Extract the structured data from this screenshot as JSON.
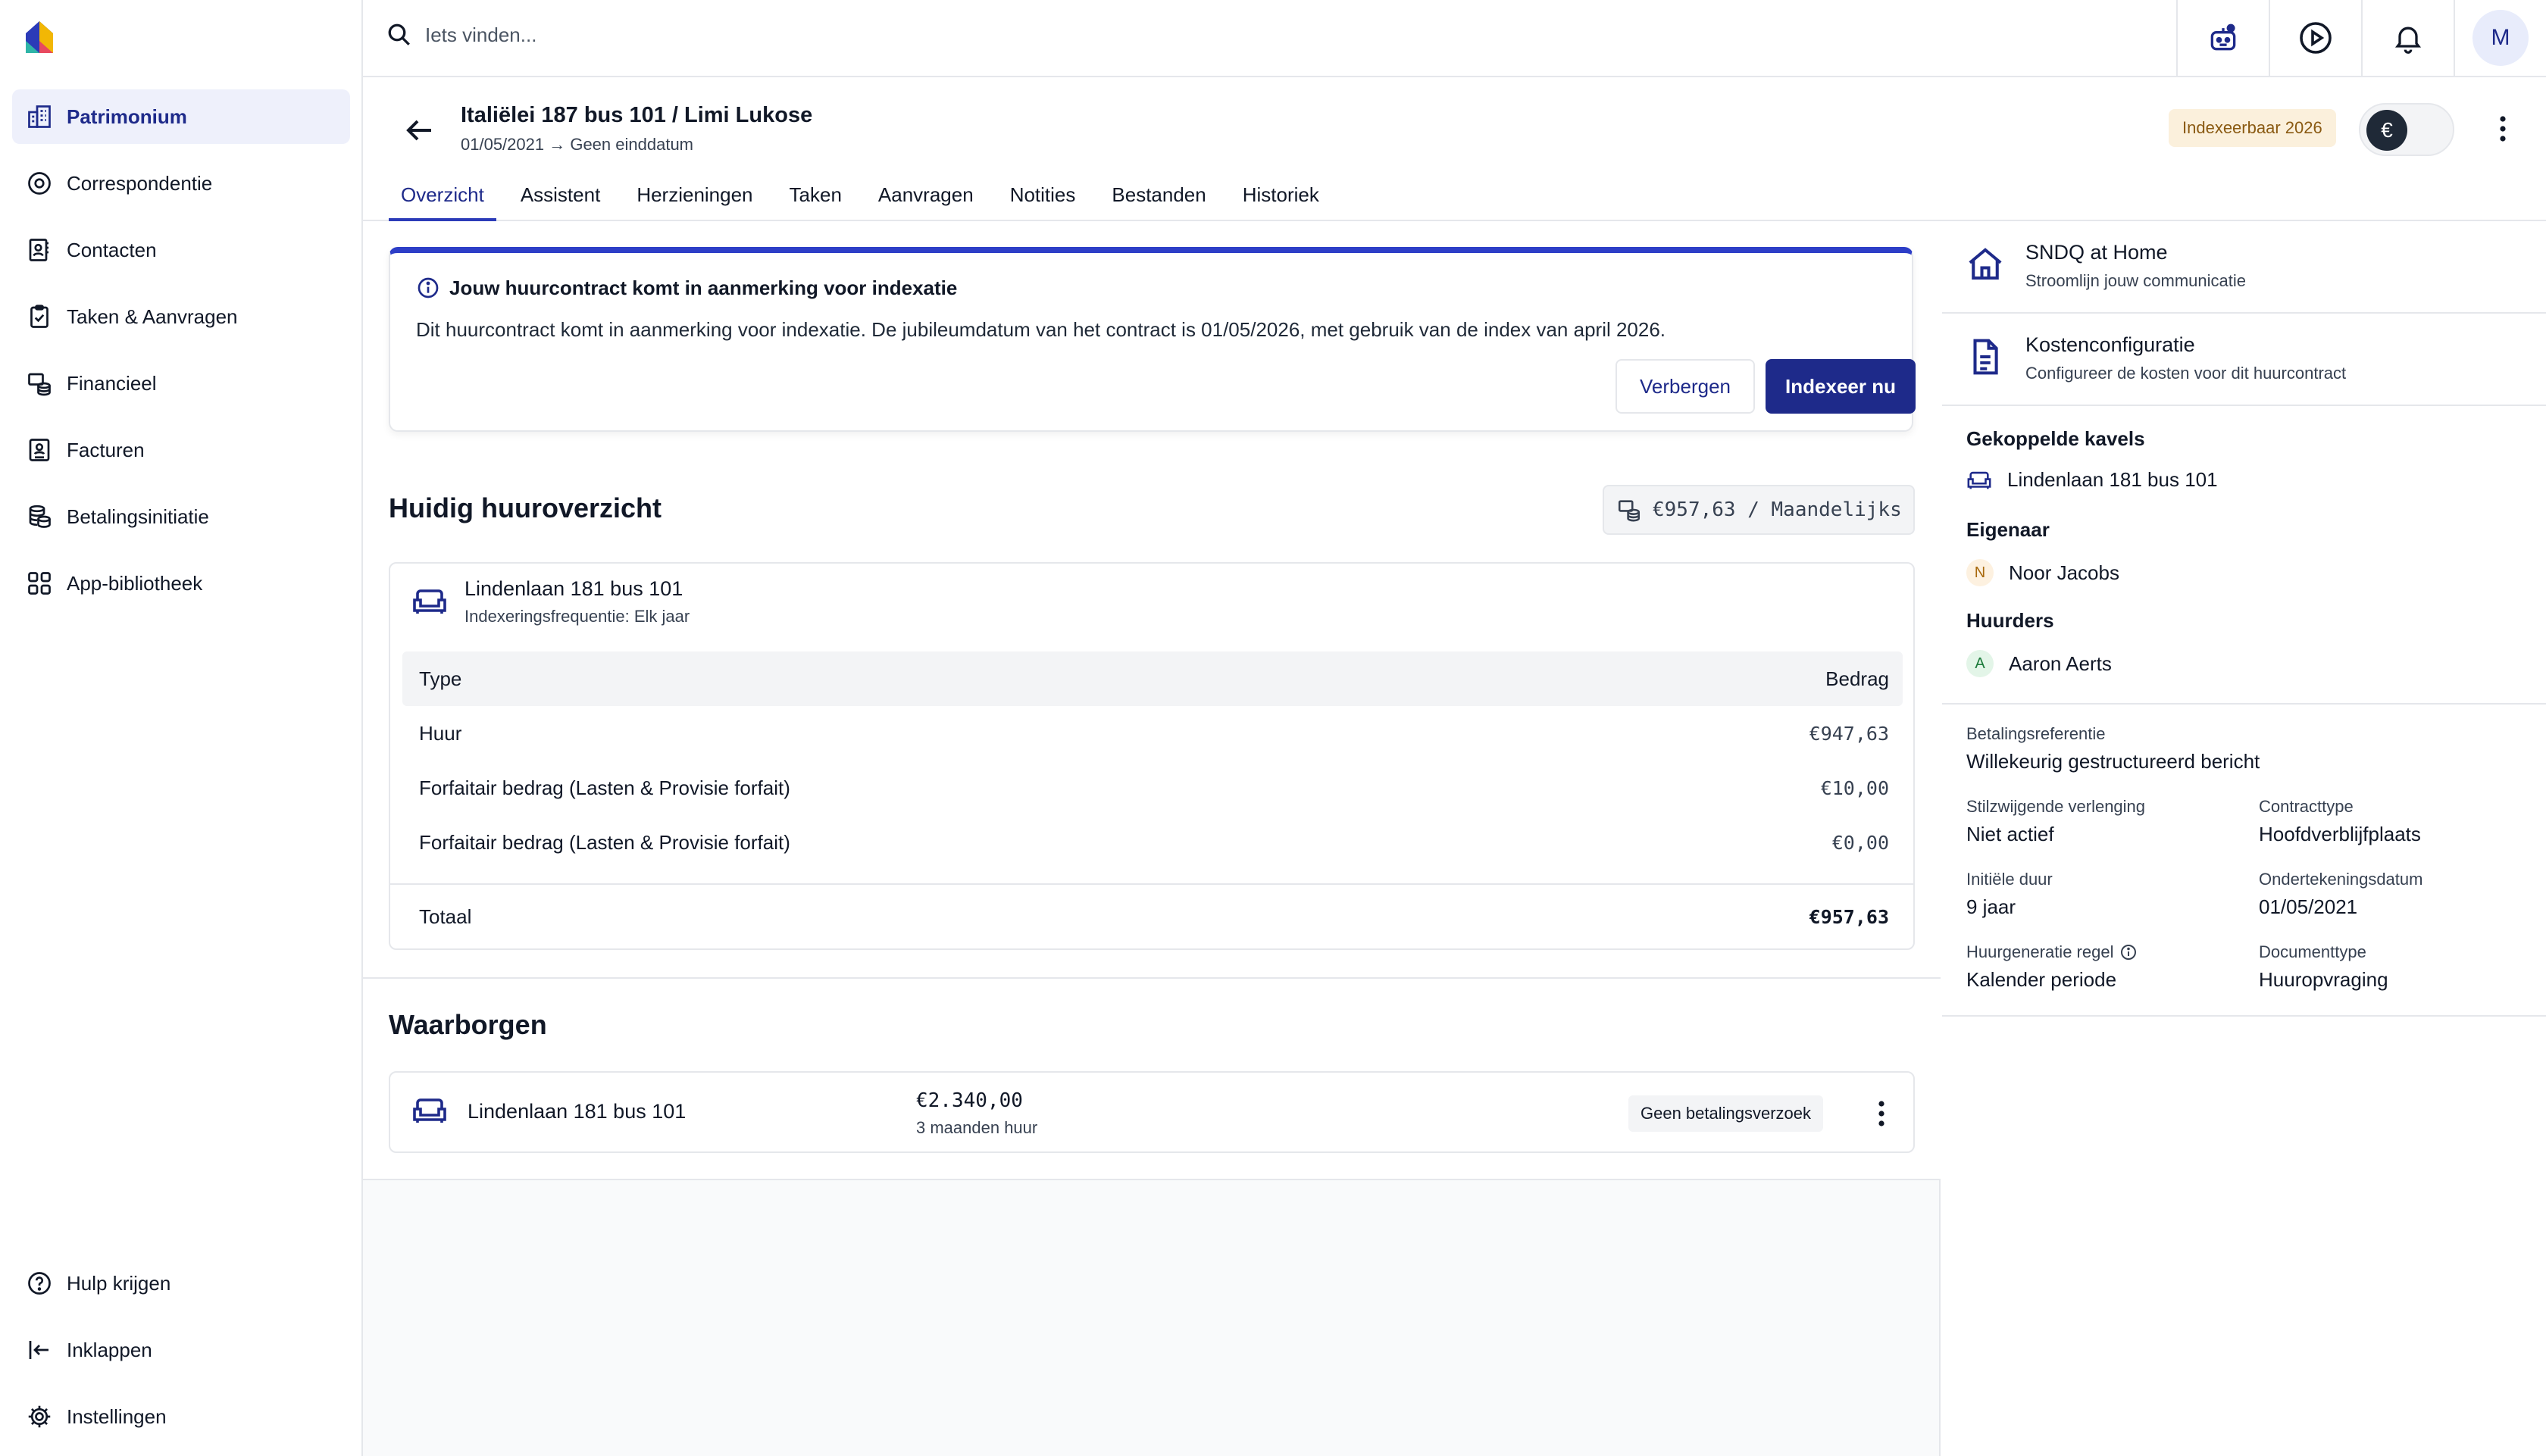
{
  "search": {
    "placeholder": "Iets vinden..."
  },
  "user": {
    "initial": "M"
  },
  "sidebar": {
    "items": [
      {
        "label": "Patrimonium",
        "icon": "building-icon",
        "active": true
      },
      {
        "label": "Correspondentie",
        "icon": "at-sign-icon"
      },
      {
        "label": "Contacten",
        "icon": "contacts-icon"
      },
      {
        "label": "Taken & Aanvragen",
        "icon": "clipboard-check-icon"
      },
      {
        "label": "Financieel",
        "icon": "coins-icon"
      },
      {
        "label": "Facturen",
        "icon": "invoice-icon"
      },
      {
        "label": "Betalingsinitiatie",
        "icon": "database-coins-icon"
      },
      {
        "label": "App-bibliotheek",
        "icon": "grid-icon"
      }
    ],
    "bottom": [
      {
        "label": "Hulp krijgen",
        "icon": "help-icon"
      },
      {
        "label": "Inklappen",
        "icon": "collapse-icon"
      },
      {
        "label": "Instellingen",
        "icon": "gear-icon"
      }
    ]
  },
  "header": {
    "title": "Italiëlei 187 bus 101 / Limi Lukose",
    "subtitle": "01/05/2021 → Geen einddatum",
    "badge": "Indexeerbaar 2026",
    "toggle_symbol": "€",
    "tabs": [
      {
        "label": "Overzicht",
        "active": true
      },
      {
        "label": "Assistent"
      },
      {
        "label": "Herzieningen"
      },
      {
        "label": "Taken"
      },
      {
        "label": "Aanvragen"
      },
      {
        "label": "Notities"
      },
      {
        "label": "Bestanden"
      },
      {
        "label": "Historiek"
      }
    ]
  },
  "alert": {
    "title": "Jouw huurcontract komt in aanmerking voor indexatie",
    "text": "Dit huurcontract komt in aanmerking voor indexatie. De jubileumdatum van het contract is 01/05/2026, met gebruik van de index van april 2026.",
    "hide_label": "Verbergen",
    "index_label": "Indexeer nu"
  },
  "rent": {
    "section_title": "Huidig huuroverzicht",
    "summary": "€957,63 / Maandelijks",
    "unit_name": "Lindenlaan 181 bus 101",
    "unit_sub": "Indexeringsfrequentie: Elk jaar",
    "col_type": "Type",
    "col_amount": "Bedrag",
    "rows": [
      {
        "type": "Huur",
        "amount": "€947,63"
      },
      {
        "type": "Forfaitair bedrag (Lasten & Provisie forfait)",
        "amount": "€10,00"
      },
      {
        "type": "Forfaitair bedrag (Lasten & Provisie forfait)",
        "amount": "€0,00"
      }
    ],
    "total_label": "Totaal",
    "total_amount": "€957,63"
  },
  "deposits": {
    "section_title": "Waarborgen",
    "unit_name": "Lindenlaan 181 bus 101",
    "amount": "€2.340,00",
    "amount_sub": "3 maanden huur",
    "badge": "Geen betalingsverzoek"
  },
  "right_panel": {
    "sndq": {
      "title": "SNDQ at Home",
      "sub": "Stroomlijn jouw communicatie"
    },
    "costs": {
      "title": "Kostenconfiguratie",
      "sub": "Configureer de kosten voor dit huurcontract"
    },
    "linked_heading": "Gekoppelde kavels",
    "linked_unit": "Lindenlaan 181 bus 101",
    "owner_heading": "Eigenaar",
    "owner_initial": "N",
    "owner_name": "Noor Jacobs",
    "tenants_heading": "Huurders",
    "tenant_initial": "A",
    "tenant_name": "Aaron Aerts",
    "meta": {
      "payment_ref_label": "Betalingsreferentie",
      "payment_ref_value": "Willekeurig gestructureerd bericht",
      "renewal_label": "Stilzwijgende verlenging",
      "renewal_value": "Niet actief",
      "contract_type_label": "Contracttype",
      "contract_type_value": "Hoofdverblijfplaats",
      "duration_label": "Initiële duur",
      "duration_value": "9 jaar",
      "sign_date_label": "Ondertekeningsdatum",
      "sign_date_value": "01/05/2021",
      "rent_rule_label": "Huurgeneratie regel",
      "rent_rule_value": "Kalender periode",
      "doc_type_label": "Documenttype",
      "doc_type_value": "Huuropvraging"
    }
  },
  "colors": {
    "primary": "#1e2a8a",
    "accent": "#2d3ec7",
    "badge_bg": "#fbf0dc",
    "badge_text": "#8a5a12"
  }
}
